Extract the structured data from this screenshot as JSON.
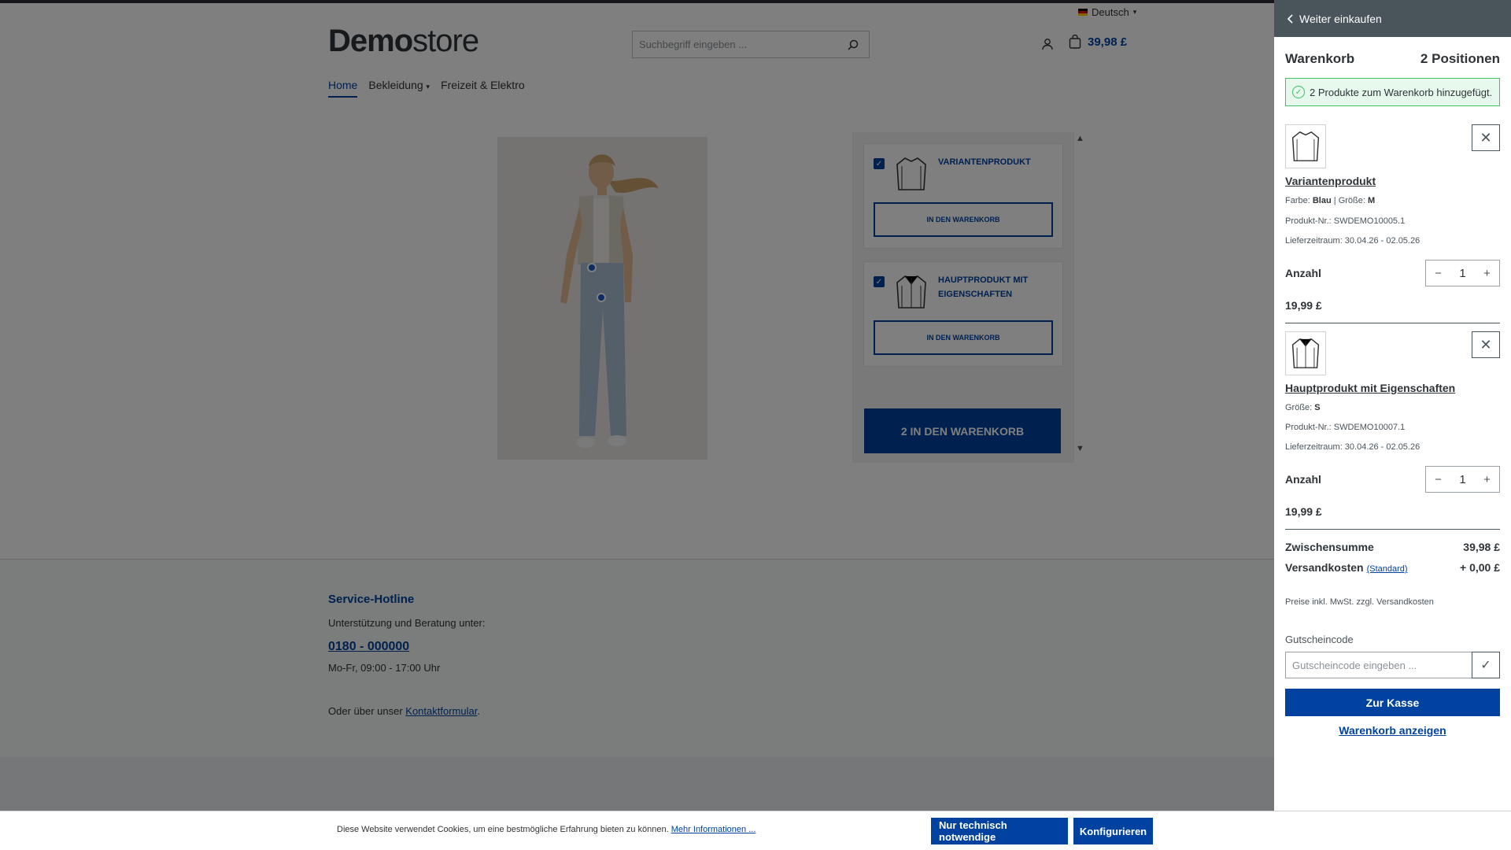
{
  "header": {
    "language": "Deutsch",
    "logo": {
      "bold": "Demo",
      "light": "store"
    },
    "search_placeholder": "Suchbegriff eingeben ...",
    "cart_total": "39,98 £"
  },
  "nav": {
    "items": [
      {
        "label": "Home",
        "active": true
      },
      {
        "label": "Bekleidung",
        "active": false
      },
      {
        "label": "Freizeit & Elektro",
        "active": false
      }
    ]
  },
  "bundle": {
    "items": [
      {
        "name": "Variantenprodukt",
        "button": "In den Warenkorb"
      },
      {
        "name": "Hauptprodukt mit Eigenschaften",
        "button": "In den Warenkorb"
      }
    ],
    "add_all_button": "2 In den Warenkorb"
  },
  "footer": {
    "title": "Service-Hotline",
    "support_text": "Unterstützung und Beratung unter:",
    "phone": "0180 - 000000",
    "hours": "Mo-Fr, 09:00 - 17:00 Uhr",
    "contact_prefix": "Oder über unser ",
    "contact_link": "Kontaktformular",
    "contact_suffix": "."
  },
  "offcanvas": {
    "back_label": "Weiter einkaufen",
    "title": "Warenkorb",
    "count": "2 Positionen",
    "alert": "2 Produkte zum Warenkorb hinzugefügt.",
    "qty_label": "Anzahl",
    "items": [
      {
        "name": "Variantenprodukt",
        "attr1_label": "Farbe:",
        "attr1_value": "Blau",
        "attr2_label": "Größe:",
        "attr2_value": "M",
        "sku": "Produkt-Nr.: SWDEMO10005.1",
        "delivery": "Lieferzeitraum: 30.04.26 - 02.05.26",
        "quantity": "1",
        "price": "19,99 £"
      },
      {
        "name": "Hauptprodukt mit Eigenschaften",
        "attr1_label": "Größe:",
        "attr1_value": "S",
        "sku": "Produkt-Nr.: SWDEMO10007.1",
        "delivery": "Lieferzeitraum: 30.04.26 - 02.05.26",
        "quantity": "1",
        "price": "19,99 £"
      }
    ],
    "subtotal_label": "Zwischensumme",
    "subtotal_value": "39,98 £",
    "shipping_label": "Versandkosten",
    "shipping_method": "(Standard)",
    "shipping_value": "+ 0,00 £",
    "tax_note": "Preise inkl. MwSt. zzgl. Versandkosten",
    "promo_label": "Gutscheincode",
    "promo_placeholder": "Gutscheincode eingeben ...",
    "checkout_button": "Zur Kasse",
    "show_cart_link": "Warenkorb anzeigen"
  },
  "cookie": {
    "text": "Diese Website verwendet Cookies, um eine bestmögliche Erfahrung bieten zu können. ",
    "more_link": "Mehr Informationen ...",
    "btn_necessary": "Nur technisch notwendige",
    "btn_configure": "Konfigurieren"
  },
  "colors": {
    "primary": "#0042a0",
    "success": "#3cc261",
    "offcanvas_header": "#4a545b"
  },
  "icons": [
    "chevron-left-icon",
    "search-icon",
    "user-icon",
    "bag-icon",
    "check-circle-icon",
    "close-icon",
    "check-icon",
    "plus-icon",
    "minus-icon",
    "flag-de-icon",
    "caret-down-icon",
    "shirt-icon",
    "jacket-icon"
  ]
}
